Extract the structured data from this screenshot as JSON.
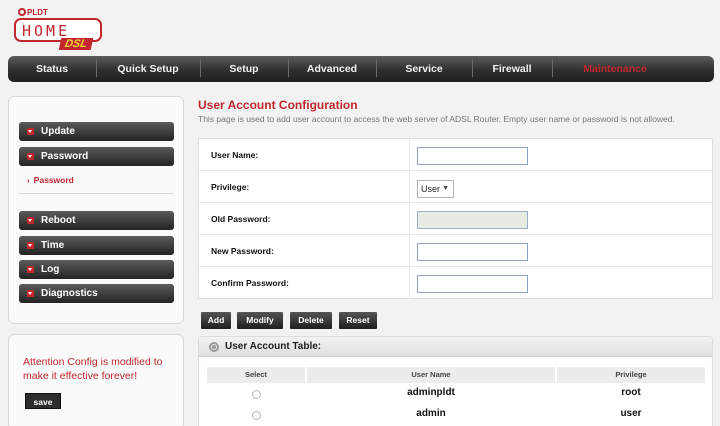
{
  "logo": {
    "brand": "PLDT",
    "product": "HOME",
    "tag": "DSL"
  },
  "nav": [
    {
      "label": "Status"
    },
    {
      "label": "Quick Setup"
    },
    {
      "label": "Setup"
    },
    {
      "label": "Advanced"
    },
    {
      "label": "Service"
    },
    {
      "label": "Firewall"
    },
    {
      "label": "Maintenance",
      "active": true
    }
  ],
  "sidebar": {
    "items": [
      {
        "label": "Update"
      },
      {
        "label": "Password"
      },
      {
        "label": "Reboot"
      },
      {
        "label": "Time"
      },
      {
        "label": "Log"
      },
      {
        "label": "Diagnostics"
      }
    ],
    "sub_item": "Password"
  },
  "notice": {
    "text": "Attention Config is modified to make it effective forever!",
    "save_label": "save"
  },
  "page": {
    "title": "User Account Configuration",
    "description": "This page is used to add user account to access the web server of ADSL Router. Empty user name or password is not allowed."
  },
  "form": {
    "username_label": "User Name:",
    "username_value": "",
    "privilege_label": "Privilege:",
    "privilege_value": "User",
    "old_password_label": "Old Password:",
    "new_password_label": "New Password:",
    "confirm_password_label": "Confirm Password:"
  },
  "actions": {
    "add": "Add",
    "modify": "Modify",
    "delete": "Delete",
    "reset": "Reset"
  },
  "table": {
    "title": "User Account Table:",
    "columns": [
      "Select",
      "User Name",
      "Privilege"
    ],
    "rows": [
      {
        "user": "adminpldt",
        "privilege": "root"
      },
      {
        "user": "admin",
        "privilege": "user"
      }
    ]
  },
  "colors": {
    "accent": "#c0272d",
    "nav_bg": "#2a2a2a",
    "button_bg": "#2d2d2d"
  },
  "icons": {
    "menu_arrow": "chevron-down-icon",
    "table_header": "gear-icon"
  }
}
